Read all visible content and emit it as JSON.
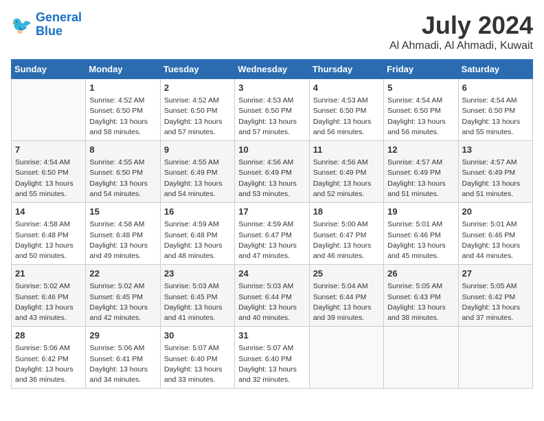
{
  "logo": {
    "line1": "General",
    "line2": "Blue"
  },
  "title": "July 2024",
  "location": "Al Ahmadi, Al Ahmadi, Kuwait",
  "weekdays": [
    "Sunday",
    "Monday",
    "Tuesday",
    "Wednesday",
    "Thursday",
    "Friday",
    "Saturday"
  ],
  "weeks": [
    [
      {
        "day": "",
        "info": ""
      },
      {
        "day": "1",
        "info": "Sunrise: 4:52 AM\nSunset: 6:50 PM\nDaylight: 13 hours\nand 58 minutes."
      },
      {
        "day": "2",
        "info": "Sunrise: 4:52 AM\nSunset: 6:50 PM\nDaylight: 13 hours\nand 57 minutes."
      },
      {
        "day": "3",
        "info": "Sunrise: 4:53 AM\nSunset: 6:50 PM\nDaylight: 13 hours\nand 57 minutes."
      },
      {
        "day": "4",
        "info": "Sunrise: 4:53 AM\nSunset: 6:50 PM\nDaylight: 13 hours\nand 56 minutes."
      },
      {
        "day": "5",
        "info": "Sunrise: 4:54 AM\nSunset: 6:50 PM\nDaylight: 13 hours\nand 56 minutes."
      },
      {
        "day": "6",
        "info": "Sunrise: 4:54 AM\nSunset: 6:50 PM\nDaylight: 13 hours\nand 55 minutes."
      }
    ],
    [
      {
        "day": "7",
        "info": "Sunrise: 4:54 AM\nSunset: 6:50 PM\nDaylight: 13 hours\nand 55 minutes."
      },
      {
        "day": "8",
        "info": "Sunrise: 4:55 AM\nSunset: 6:50 PM\nDaylight: 13 hours\nand 54 minutes."
      },
      {
        "day": "9",
        "info": "Sunrise: 4:55 AM\nSunset: 6:49 PM\nDaylight: 13 hours\nand 54 minutes."
      },
      {
        "day": "10",
        "info": "Sunrise: 4:56 AM\nSunset: 6:49 PM\nDaylight: 13 hours\nand 53 minutes."
      },
      {
        "day": "11",
        "info": "Sunrise: 4:56 AM\nSunset: 6:49 PM\nDaylight: 13 hours\nand 52 minutes."
      },
      {
        "day": "12",
        "info": "Sunrise: 4:57 AM\nSunset: 6:49 PM\nDaylight: 13 hours\nand 51 minutes."
      },
      {
        "day": "13",
        "info": "Sunrise: 4:57 AM\nSunset: 6:49 PM\nDaylight: 13 hours\nand 51 minutes."
      }
    ],
    [
      {
        "day": "14",
        "info": "Sunrise: 4:58 AM\nSunset: 6:48 PM\nDaylight: 13 hours\nand 50 minutes."
      },
      {
        "day": "15",
        "info": "Sunrise: 4:58 AM\nSunset: 6:48 PM\nDaylight: 13 hours\nand 49 minutes."
      },
      {
        "day": "16",
        "info": "Sunrise: 4:59 AM\nSunset: 6:48 PM\nDaylight: 13 hours\nand 48 minutes."
      },
      {
        "day": "17",
        "info": "Sunrise: 4:59 AM\nSunset: 6:47 PM\nDaylight: 13 hours\nand 47 minutes."
      },
      {
        "day": "18",
        "info": "Sunrise: 5:00 AM\nSunset: 6:47 PM\nDaylight: 13 hours\nand 46 minutes."
      },
      {
        "day": "19",
        "info": "Sunrise: 5:01 AM\nSunset: 6:46 PM\nDaylight: 13 hours\nand 45 minutes."
      },
      {
        "day": "20",
        "info": "Sunrise: 5:01 AM\nSunset: 6:46 PM\nDaylight: 13 hours\nand 44 minutes."
      }
    ],
    [
      {
        "day": "21",
        "info": "Sunrise: 5:02 AM\nSunset: 6:46 PM\nDaylight: 13 hours\nand 43 minutes."
      },
      {
        "day": "22",
        "info": "Sunrise: 5:02 AM\nSunset: 6:45 PM\nDaylight: 13 hours\nand 42 minutes."
      },
      {
        "day": "23",
        "info": "Sunrise: 5:03 AM\nSunset: 6:45 PM\nDaylight: 13 hours\nand 41 minutes."
      },
      {
        "day": "24",
        "info": "Sunrise: 5:03 AM\nSunset: 6:44 PM\nDaylight: 13 hours\nand 40 minutes."
      },
      {
        "day": "25",
        "info": "Sunrise: 5:04 AM\nSunset: 6:44 PM\nDaylight: 13 hours\nand 39 minutes."
      },
      {
        "day": "26",
        "info": "Sunrise: 5:05 AM\nSunset: 6:43 PM\nDaylight: 13 hours\nand 38 minutes."
      },
      {
        "day": "27",
        "info": "Sunrise: 5:05 AM\nSunset: 6:42 PM\nDaylight: 13 hours\nand 37 minutes."
      }
    ],
    [
      {
        "day": "28",
        "info": "Sunrise: 5:06 AM\nSunset: 6:42 PM\nDaylight: 13 hours\nand 36 minutes."
      },
      {
        "day": "29",
        "info": "Sunrise: 5:06 AM\nSunset: 6:41 PM\nDaylight: 13 hours\nand 34 minutes."
      },
      {
        "day": "30",
        "info": "Sunrise: 5:07 AM\nSunset: 6:40 PM\nDaylight: 13 hours\nand 33 minutes."
      },
      {
        "day": "31",
        "info": "Sunrise: 5:07 AM\nSunset: 6:40 PM\nDaylight: 13 hours\nand 32 minutes."
      },
      {
        "day": "",
        "info": ""
      },
      {
        "day": "",
        "info": ""
      },
      {
        "day": "",
        "info": ""
      }
    ]
  ]
}
